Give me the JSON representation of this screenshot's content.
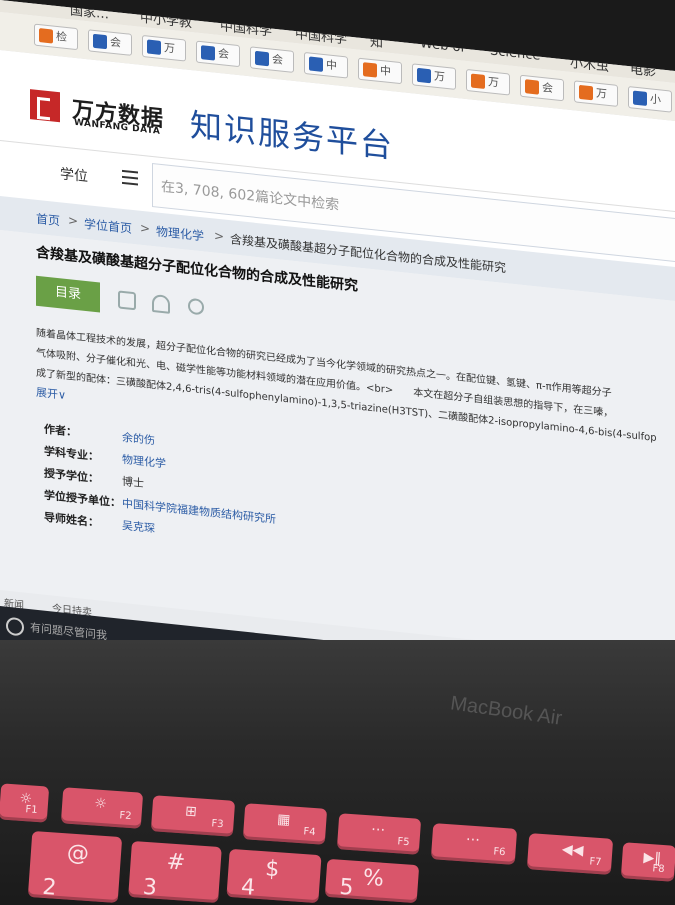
{
  "bookmarks_top": [
    "国家…",
    "中小学教",
    "中国科学",
    "中国科学",
    "知",
    "Web of",
    "Science",
    "小木虫",
    "电影"
  ],
  "bookmarks_row": [
    "检",
    "会",
    "万",
    "会",
    "会",
    "中",
    "中",
    "万",
    "万",
    "会",
    "万",
    "小"
  ],
  "logo": {
    "cn": "万方数据",
    "en": "WANFANG DATA",
    "platform": "知识服务平台"
  },
  "search": {
    "scope": "学位",
    "placeholder": "在3, 708, 602篇论文中检索"
  },
  "breadcrumb": {
    "home": "首页",
    "level1": "学位首页",
    "level2": "物理化学",
    "current": "含羧基及磺酸基超分子配位化合物的合成及性能研究",
    "sep": ">"
  },
  "article": {
    "title": "含羧基及磺酸基超分子配位化合物的合成及性能研究",
    "toc_label": "目录",
    "abstract_lines": [
      "随着晶体工程技术的发展，超分子配位化合物的研究已经成为了当今化学领域的研究热点之一。在配位键、氢键、π-π作用等超分子",
      "气体吸附、分子催化和光、电、磁学性能等功能材料领域的潜在应用价值。<br>　　本文在超分子自组装思想的指导下，在三嗪，",
      "成了新型的配体：三磺酸配体2,4,6-tris(4-sulfophenylamino)-1,3,5-triazine(H3TST)、二磺酸配体2-isopropylamino-4,6-bis(4-sulfop"
    ],
    "expand_label": "展开∨"
  },
  "meta": [
    {
      "key": "作者：",
      "value": "余的伤",
      "link": true
    },
    {
      "key": "学科专业：",
      "value": "物理化学",
      "link": true
    },
    {
      "key": "授予学位：",
      "value": "博士",
      "link": false
    },
    {
      "key": "学位授予单位：",
      "value": "中国科学院福建物质结构研究所",
      "link": true
    },
    {
      "key": "导师姓名：",
      "value": "吴克琛",
      "link": true
    }
  ],
  "bottom": {
    "left": "新闻",
    "item": "今日持卖"
  },
  "taskbar": {
    "ask": "有问题尽管问我"
  },
  "keyboard": {
    "keys": [
      {
        "sym": "☼",
        "lab": "F1"
      },
      {
        "sym": "☼",
        "lab": "F2"
      },
      {
        "sym": "⊞",
        "lab": "F3"
      },
      {
        "sym": "▦",
        "lab": "F4"
      },
      {
        "sym": "⋯",
        "lab": "F5"
      },
      {
        "sym": "⋯",
        "lab": "F6"
      },
      {
        "sym": "◀◀",
        "lab": "F7"
      },
      {
        "sym": "▶‖",
        "lab": "F8"
      }
    ],
    "num_keys": [
      {
        "sym": "@",
        "lab": "2"
      },
      {
        "sym": "#",
        "lab": "3"
      },
      {
        "sym": "$",
        "lab": "4"
      },
      {
        "sym": "%",
        "lab": "5"
      }
    ]
  },
  "device_label": "MacBook Air"
}
